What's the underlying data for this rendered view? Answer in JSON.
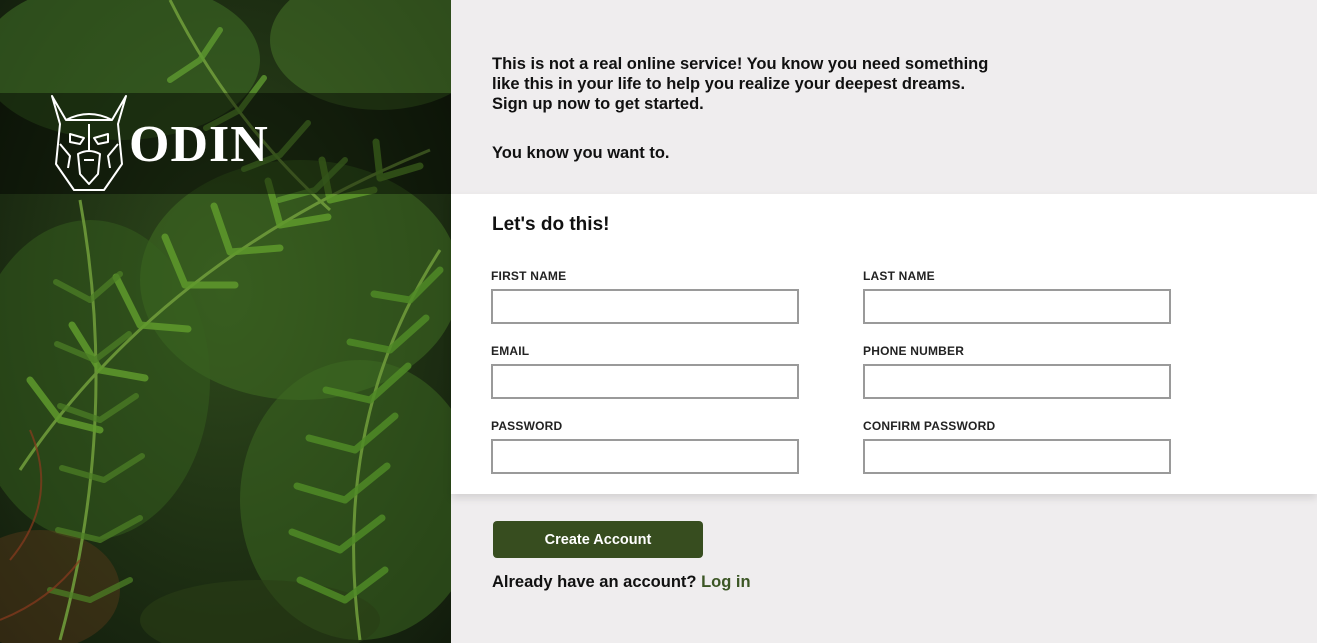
{
  "brand": {
    "name": "ODIN"
  },
  "intro": {
    "lines": [
      "This is not a real online service! You know you need something",
      "like this in your life to help you realize your deepest dreams.",
      "Sign up now to get started."
    ],
    "tagline": "You know you want to."
  },
  "form": {
    "title": "Let's do this!",
    "fields": {
      "first_name": {
        "label": "FIRST NAME",
        "value": ""
      },
      "last_name": {
        "label": "LAST NAME",
        "value": ""
      },
      "email": {
        "label": "EMAIL",
        "value": ""
      },
      "phone": {
        "label": "PHONE NUMBER",
        "value": ""
      },
      "password": {
        "label": "PASSWORD",
        "value": ""
      },
      "confirm_password": {
        "label": "CONFIRM PASSWORD",
        "value": ""
      }
    }
  },
  "actions": {
    "create_label": "Create Account",
    "login_prompt": "Already have an account?",
    "login_link": "Log in"
  },
  "colors": {
    "accent": "#374d1f",
    "link": "#3c5625",
    "background": "#efedee"
  }
}
